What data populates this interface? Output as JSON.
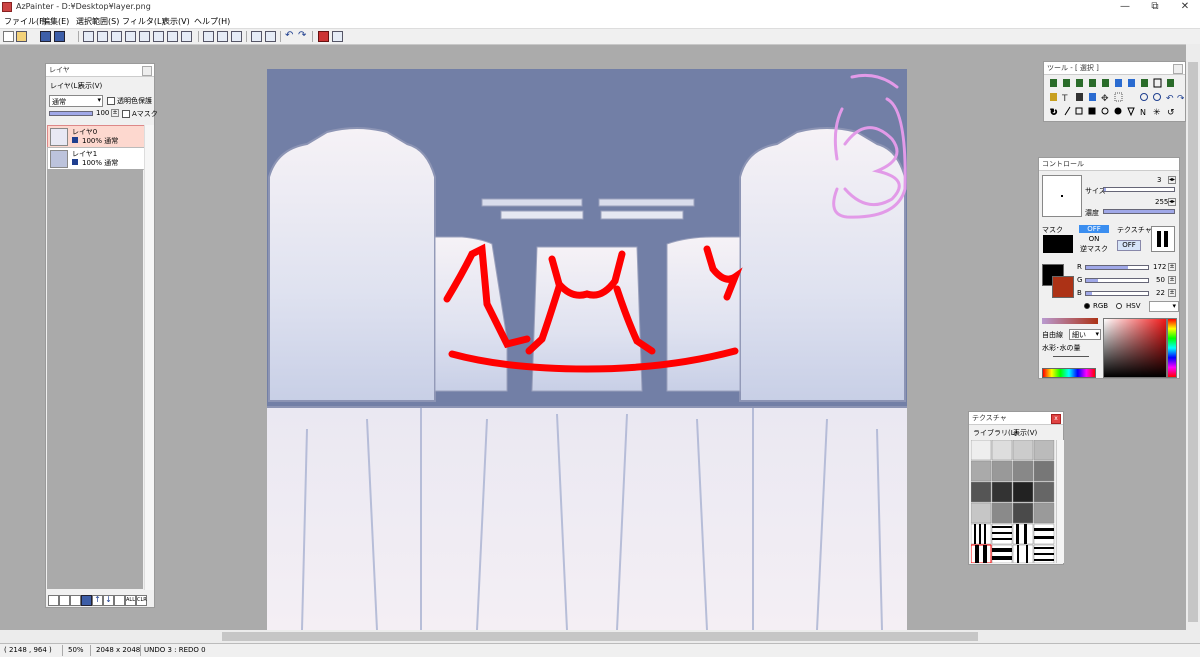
{
  "window": {
    "title": "AzPainter - D:¥Desktop¥layer.png",
    "minimize": "—",
    "maximize": "⧉",
    "close": "✕"
  },
  "menu": [
    "ファイル(F)",
    "編集(E)",
    "選択範囲(S)",
    "フィルタ(L)",
    "表示(V)",
    "ヘルプ(H)"
  ],
  "layer_panel": {
    "title": "レイヤ",
    "menu": [
      "レイヤ(L)",
      "表示(V)"
    ],
    "blend_mode": "通常",
    "protect_alpha_label": "透明色保護",
    "opacity": "100",
    "amask_label": "Aマスク",
    "layers": [
      {
        "name": "レイヤ0",
        "info": "100% 通常",
        "selected": true
      },
      {
        "name": "レイヤ1",
        "info": "100% 通常",
        "selected": false
      }
    ],
    "bottom_buttons": [
      "new-layer",
      "copy-layer",
      "merge-layer",
      "delete-layer",
      "move-up",
      "move-down",
      "properties",
      "all",
      "clr"
    ]
  },
  "tool_panel": {
    "title": "ツール - [ 選択 ]"
  },
  "control_panel": {
    "title": "コントロール",
    "size_label": "サイズ",
    "size_value": "3",
    "density_label": "濃度",
    "density_value": "255",
    "mask_label": "マスク",
    "mask_off": "OFF",
    "mask_on": "ON",
    "mask_reverse": "逆マスク",
    "texture_label": "テクスチャ",
    "texture_off": "OFF",
    "r_label": "R",
    "r_value": "172",
    "g_label": "G",
    "g_value": "50",
    "b_label": "B",
    "b_value": "22",
    "rgb_label": "RGB",
    "hsv_label": "HSV",
    "curve_label": "自由線",
    "curve_value": "細い",
    "watercolor_label": "水彩･水の量",
    "fg_color": "#000000",
    "bg_color": "#ac3216"
  },
  "texture_panel": {
    "title": "テクスチャ",
    "close": "x",
    "menu": [
      "ライブラリ(L)",
      "表示(V)"
    ]
  },
  "status": {
    "coords": "( 2148 , 964 )",
    "zoom": "50%",
    "size": "2048 x 2048",
    "undo": "UNDO  3 : REDO  0"
  }
}
